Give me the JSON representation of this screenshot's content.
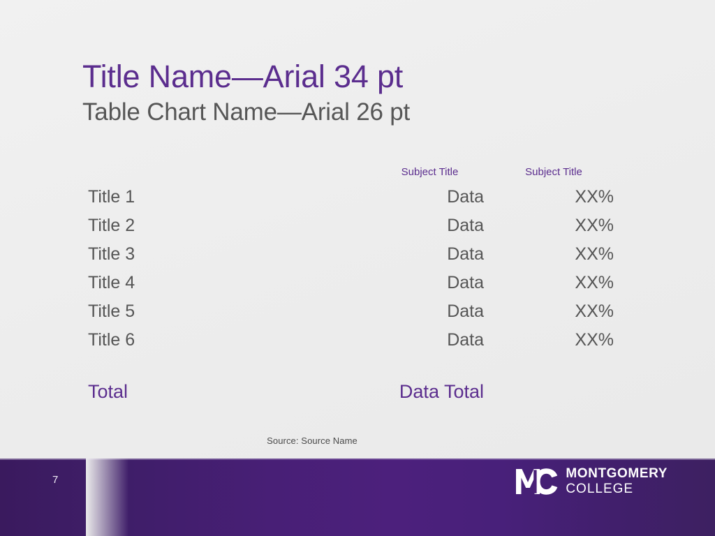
{
  "slide": {
    "title": "Title Name—Arial 34 pt",
    "subtitle": "Table Chart Name—Arial 26 pt",
    "source_note": "Source: Source Name",
    "background_color": "#ededed",
    "accent_color": "#5b2d8e",
    "body_text_color": "#555555"
  },
  "chart_data": {
    "type": "table",
    "title": "Table Chart Name—Arial 26 pt",
    "columns": [
      "",
      "Subject Title",
      "Subject Title"
    ],
    "rows": [
      {
        "label": "Title 1",
        "data": "Data",
        "pct": "XX%"
      },
      {
        "label": "Title 2",
        "data": "Data",
        "pct": "XX%"
      },
      {
        "label": "Title 3",
        "data": "Data",
        "pct": "XX%"
      },
      {
        "label": "Title 4",
        "data": "Data",
        "pct": "XX%"
      },
      {
        "label": "Title 5",
        "data": "Data",
        "pct": "XX%"
      },
      {
        "label": "Title 6",
        "data": "Data",
        "pct": "XX%"
      }
    ],
    "total_row": {
      "label": "Total",
      "data": "Data Total",
      "pct": ""
    },
    "source": "Source: Source Name"
  },
  "footer": {
    "page_number": "7",
    "logo_line1": "MONTGOMERY",
    "logo_line2": "COLLEGE",
    "logo_mark": "mc-monogram",
    "gradient_left": "#3a1a5e",
    "gradient_center": "#4c207c",
    "gradient_right": "#3d2061"
  }
}
